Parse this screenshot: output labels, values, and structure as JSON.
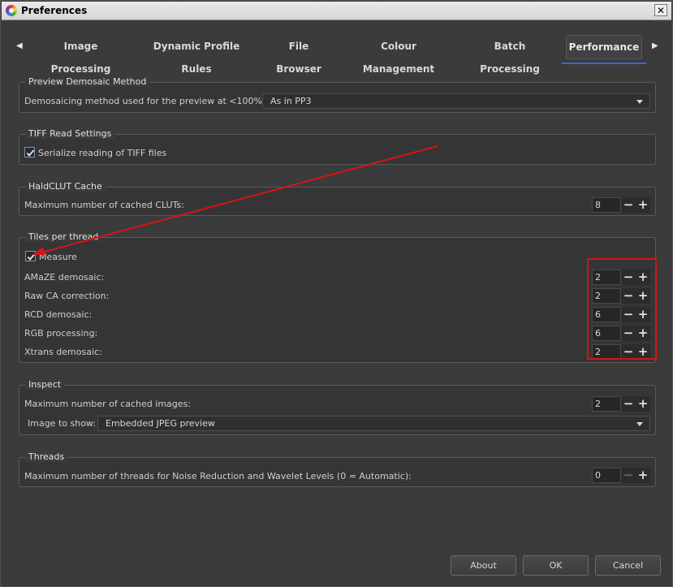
{
  "window": {
    "title": "Preferences",
    "close_glyph": "✕",
    "logo_icon": "rawtherapee-logo-icon"
  },
  "tabs": {
    "left_arrow": "◀",
    "right_arrow": "▶",
    "items": [
      {
        "label": "Image Processing"
      },
      {
        "label": "Dynamic Profile Rules"
      },
      {
        "label": "File Browser"
      },
      {
        "label": "Colour Management"
      },
      {
        "label": "Batch Processing"
      },
      {
        "label": "Performance",
        "active": true
      }
    ]
  },
  "preview_demosaic": {
    "title": "Preview Demosaic Method",
    "label": "Demosaicing method used for the preview at <100% zoom:",
    "value": "As in PP3"
  },
  "tiff": {
    "title": "TIFF Read Settings",
    "checkbox_label": "Serialize reading of TIFF files",
    "checked": true
  },
  "haldclut": {
    "title": "HaldCLUT Cache",
    "label": "Maximum number of cached CLUTs:",
    "value": "8"
  },
  "tiles": {
    "title": "Tiles per thread",
    "measure_label": "Measure",
    "measure_checked": true,
    "rows": [
      {
        "label": "AMaZE demosaic:",
        "value": "2"
      },
      {
        "label": "Raw CA correction:",
        "value": "2"
      },
      {
        "label": "RCD demosaic:",
        "value": "6"
      },
      {
        "label": "RGB processing:",
        "value": "6"
      },
      {
        "label": "Xtrans demosaic:",
        "value": "2"
      }
    ]
  },
  "inspect": {
    "title": "Inspect",
    "cached_label": "Maximum number of cached images:",
    "cached_value": "2",
    "show_label": "Image to show:",
    "show_value": "Embedded JPEG preview"
  },
  "threads": {
    "title": "Threads",
    "label": "Maximum number of threads for Noise Reduction and Wavelet Levels (0 = Automatic):",
    "value": "0"
  },
  "spin": {
    "minus": "−",
    "plus": "+"
  },
  "buttons": {
    "about": "About",
    "ok": "OK",
    "cancel": "Cancel"
  },
  "annotation_color": "#d41515"
}
